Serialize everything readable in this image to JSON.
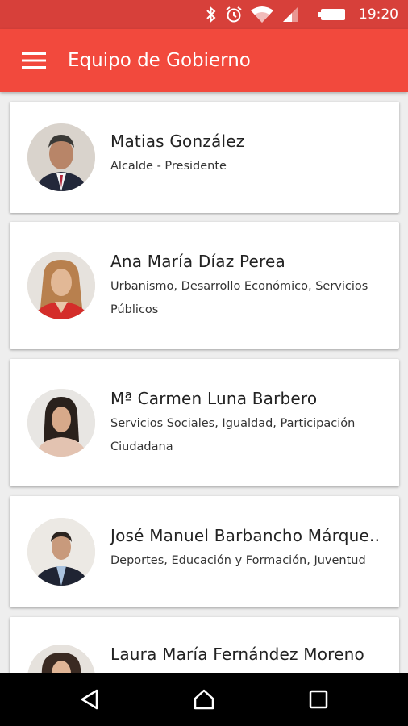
{
  "status_bar": {
    "time": "19:20",
    "icons": [
      "bluetooth-icon",
      "alarm-icon",
      "wifi-icon",
      "signal-icon",
      "battery-icon"
    ]
  },
  "app_bar": {
    "title": "Equipo de Gobierno",
    "menu_icon": "hamburger-menu-icon",
    "background": "#f2493d"
  },
  "members": [
    {
      "name": "Matias González",
      "role": "Alcalde - Presidente"
    },
    {
      "name": "Ana María Díaz Perea",
      "role": "Urbanismo, Desarrollo Económico, Servicios Públicos"
    },
    {
      "name": "Mª Carmen Luna Barbero",
      "role": "Servicios Sociales, Igualdad, Participación Ciudadana"
    },
    {
      "name": "José Manuel Barbancho Márque..",
      "role": "Deportes, Educación y Formación, Juventud"
    },
    {
      "name": "Laura María Fernández Moreno",
      "role": ""
    }
  ],
  "nav_bar": {
    "buttons": [
      "back-icon",
      "home-icon",
      "recents-icon"
    ]
  },
  "colors": {
    "status_bar": "#d7403a",
    "app_bar": "#f2493d",
    "background": "#eeeeee"
  }
}
